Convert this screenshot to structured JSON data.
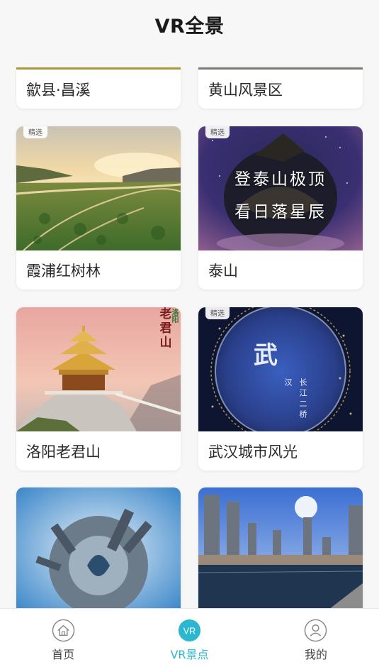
{
  "header": {
    "title": "VR全景"
  },
  "top_partial": [
    {
      "label": "歙县·昌溪"
    },
    {
      "label": "黄山风景区"
    }
  ],
  "cards": [
    {
      "label": "霞浦红树林",
      "badge": "精选"
    },
    {
      "label": "泰山",
      "badge": "精选",
      "overlay_lines": [
        "登泰山极顶",
        "看日落星辰"
      ]
    },
    {
      "label": "洛阳老君山",
      "badge": "",
      "overlay_lines": [
        "老君山"
      ],
      "overlay_sub": "洛阳"
    },
    {
      "label": "武汉城市风光",
      "badge": "精选",
      "overlay_title": "武",
      "overlay_vertical": [
        "汉",
        "长江二桥"
      ]
    },
    {
      "label": "",
      "badge": ""
    },
    {
      "label": "",
      "badge": ""
    }
  ],
  "tabbar": {
    "items": [
      {
        "label": "首页",
        "icon": "home-icon"
      },
      {
        "label": "VR景点",
        "icon": "vr-icon",
        "active": true
      },
      {
        "label": "我的",
        "icon": "user-icon"
      }
    ]
  },
  "colors": {
    "accent": "#2bb7d0",
    "background": "#f7f7f7"
  }
}
